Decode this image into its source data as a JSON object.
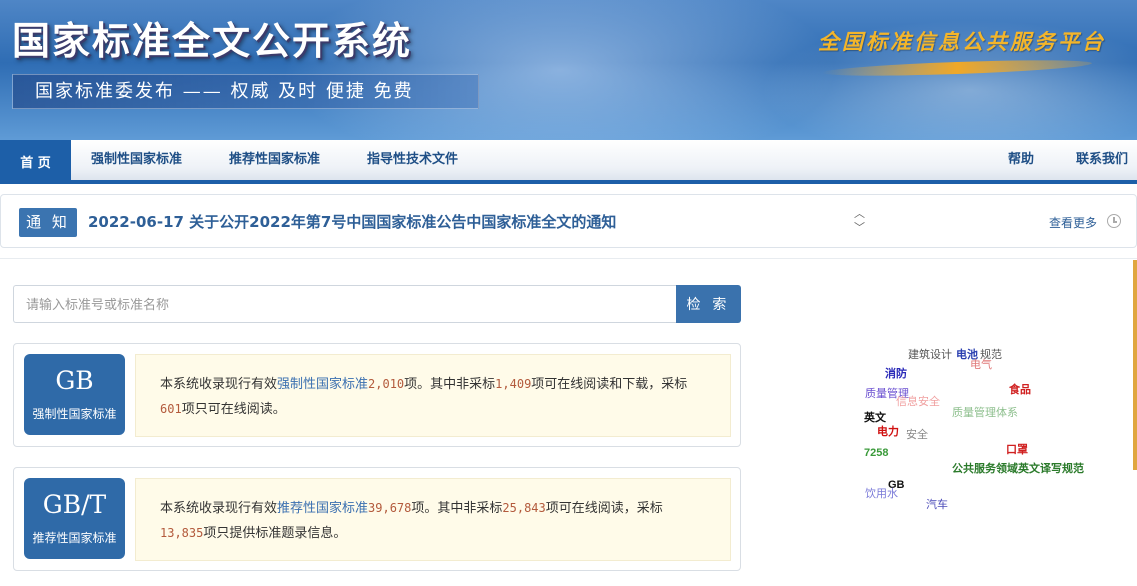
{
  "banner": {
    "site_title": "国家标准全文公开系统",
    "slogan": "国家标准委发布 —— 权威 及时 便捷 免费",
    "platform": "全国标准信息公共服务平台",
    "platform_color": "#f3b52a"
  },
  "nav": {
    "home": "首 页",
    "mandatory": "强制性国家标准",
    "recommended": "推荐性国家标准",
    "guiding": "指导性技术文件",
    "help": "帮助",
    "contact": "联系我们"
  },
  "notice": {
    "badge": "通 知",
    "text": "2022-06-17  关于公开2022年第7号中国国家标准公告中国家标准全文的通知",
    "more": "查看更多",
    "icons": [
      "chevron-up-icon",
      "chevron-down-icon",
      "clock-icon"
    ]
  },
  "search": {
    "placeholder": "请输入标准号或标准名称",
    "button": "检 索"
  },
  "gb": {
    "code": "GB",
    "label": "强制性国家标准",
    "prefix": "本系统收录现行有效",
    "link": "强制性国家标准",
    "total": "2,010",
    "mid1": "项。其中非采标",
    "nonadopt": "1,409",
    "mid2": "项可在线阅读和下载，采标",
    "adopt": "601",
    "suffix": "项只可在线阅读。"
  },
  "gbt": {
    "code": "GB/T",
    "label": "推荐性国家标准",
    "prefix": "本系统收录现行有效",
    "link": "推荐性国家标准",
    "total": "39,678",
    "mid1": "项。其中非采标",
    "nonadopt": "25,843",
    "mid2": "项可在线阅读，采标",
    "adopt": "13,835",
    "suffix": "项只提供标准题录信息。"
  },
  "tags": [
    {
      "text": "建筑设计",
      "color": "#555555"
    },
    {
      "text": "电池",
      "color": "#2a3fb0"
    },
    {
      "text": "规范",
      "color": "#555555"
    },
    {
      "text": "电气",
      "color": "#e07a7a"
    },
    {
      "text": "消防",
      "color": "#2a2ab8"
    },
    {
      "text": "食品",
      "color": "#d02020"
    },
    {
      "text": "质量管理",
      "color": "#6a4fd0"
    },
    {
      "text": "信息安全",
      "color": "#f0a0a0"
    },
    {
      "text": "质量管理体系",
      "color": "#8fc08f"
    },
    {
      "text": "英文",
      "color": "#111111"
    },
    {
      "text": "电力",
      "color": "#d01010"
    },
    {
      "text": "安全",
      "color": "#888888"
    },
    {
      "text": "口罩",
      "color": "#d02020"
    },
    {
      "text": "7258",
      "color": "#3a9a3a"
    },
    {
      "text": "公共服务领域英文译写规范",
      "color": "#2a7a2a"
    },
    {
      "text": "GB",
      "color": "#111111"
    },
    {
      "text": "饮用水",
      "color": "#7a7ad8"
    },
    {
      "text": "汽车",
      "color": "#4a4ab8"
    }
  ]
}
